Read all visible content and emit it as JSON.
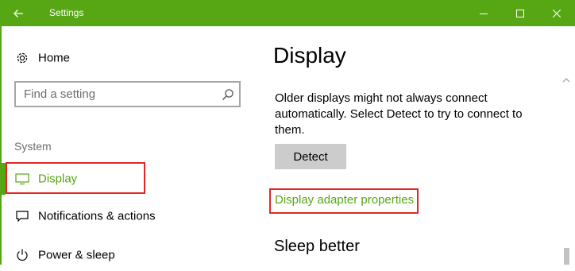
{
  "window": {
    "title": "Settings",
    "accent_color": "#57a614",
    "highlight_color": "#e02828"
  },
  "sidebar": {
    "home": {
      "label": "Home",
      "icon": "gear-icon"
    },
    "search": {
      "placeholder": "Find a setting",
      "icon": "search-icon"
    },
    "section": "System",
    "items": [
      {
        "label": "Display",
        "icon": "monitor-icon",
        "selected": true
      },
      {
        "label": "Notifications & actions",
        "icon": "notifications-icon"
      },
      {
        "label": "Power & sleep",
        "icon": "power-icon"
      }
    ]
  },
  "main": {
    "title": "Display",
    "description": "Older displays might not always connect automatically. Select Detect to try to connect to them.",
    "detect_button": "Detect",
    "adapter_link": "Display adapter properties",
    "sleep_heading": "Sleep better"
  }
}
